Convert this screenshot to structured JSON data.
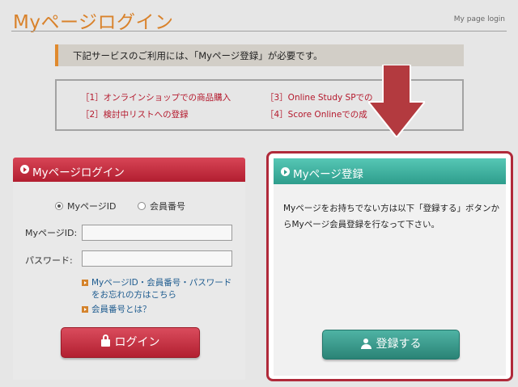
{
  "header": {
    "title": "Myページログイン",
    "subtitle": "My page login"
  },
  "notice": {
    "text": "下記サービスのご利用には、「Myページ登録」が必要です。"
  },
  "services": [
    "［1］オンラインショップでの商品購入",
    "［2］検討中リストへの登録",
    "［3］Online Study SPでの",
    "［4］Score Onlineでの成"
  ],
  "login": {
    "heading": "Myページログイン",
    "radio_options": [
      "MyページID",
      "会員番号"
    ],
    "selected_radio": "MyページID",
    "id_label": "MyページID:",
    "id_value": "",
    "password_label": "パスワード:",
    "password_value": "",
    "forgot_link": "MyページID・会員番号・パスワードをお忘れの方はこちら",
    "member_no_link": "会員番号とは？",
    "button_label": "ログイン"
  },
  "register": {
    "heading": "Myページ登録",
    "description": "Myページをお持ちでない方は以下「登録する」ボタンからMyページ会員登録を行なって下さい。",
    "button_label": "登録する"
  },
  "colors": {
    "title_orange": "#d9822b",
    "login_red": "#c02a3a",
    "register_teal": "#3fae9d",
    "highlight_frame": "#b02a3a",
    "pointer_arrow": "#b33a3f"
  }
}
